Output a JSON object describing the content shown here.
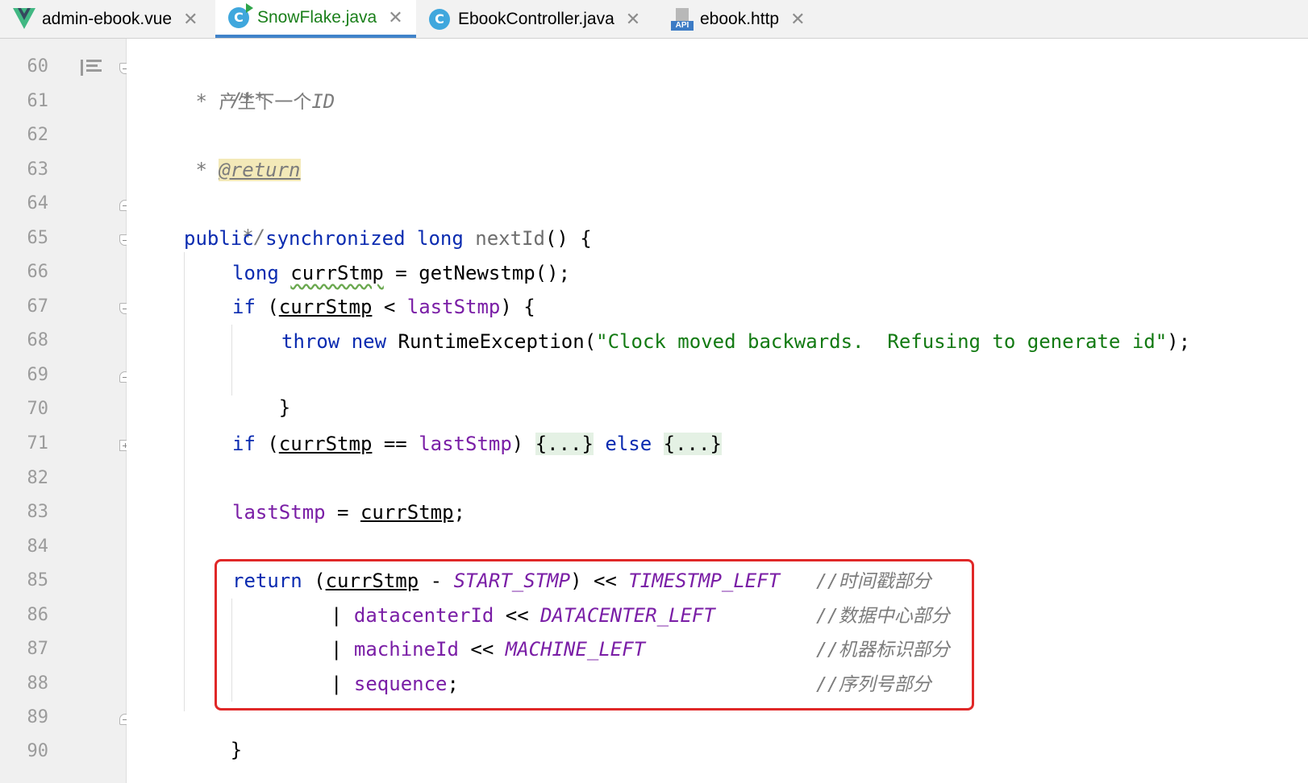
{
  "tabs": [
    {
      "label": "admin-ebook.vue",
      "icon": "vue-icon",
      "active": false
    },
    {
      "label": "SnowFlake.java",
      "icon": "java-class-icon",
      "active": true
    },
    {
      "label": "EbookController.java",
      "icon": "java-class-icon",
      "active": false
    },
    {
      "label": "ebook.http",
      "icon": "api-icon",
      "active": false
    }
  ],
  "tab_close_glyph": "✕",
  "line_numbers": [
    "60",
    "61",
    "62",
    "63",
    "64",
    "65",
    "66",
    "67",
    "68",
    "69",
    "70",
    "71",
    "82",
    "83",
    "84",
    "85",
    "86",
    "87",
    "88",
    "89",
    "90"
  ],
  "code": {
    "l60": "/**",
    "l61_star": " * ",
    "l61_text": "产生下一个",
    "l61_id": "ID",
    "l62": " *",
    "l63_star": " * ",
    "l63_tag": "@return",
    "l64": " */",
    "l65_public": "public",
    "l65_sync": "synchronized",
    "l65_long": "long",
    "l65_name": "nextId",
    "l65_rest": "() {",
    "l66_long": "long",
    "l66_var": "currStmp",
    "l66_rest": " = getNewstmp();",
    "l67_if": "if",
    "l67_open": " (",
    "l67_var": "currStmp",
    "l67_op": " < ",
    "l67_field": "lastStmp",
    "l67_close": ") {",
    "l68_throw": "throw",
    "l68_new": "new",
    "l68_cls": " RuntimeException(",
    "l68_str": "\"Clock moved backwards.  Refusing to generate id\"",
    "l68_end": ");",
    "l69": "}",
    "l71_if": "if",
    "l71_open": " (",
    "l71_var": "currStmp",
    "l71_op": " == ",
    "l71_field": "lastStmp",
    "l71_close": ") ",
    "l71_fold1": "{...}",
    "l71_else": "else",
    "l71_fold2": "{...}",
    "l83_field": "lastStmp",
    "l83_op": " = ",
    "l83_var": "currStmp",
    "l83_end": ";",
    "l85_return": "return",
    "l85_open": " (",
    "l85_var": "currStmp",
    "l85_minus": " - ",
    "l85_c1": "START_STMP",
    "l85_mid": ") << ",
    "l85_c2": "TIMESTMP_LEFT",
    "l85_cmt": "//时间戳部分",
    "l86_bar": "| ",
    "l86_field": "datacenterId",
    "l86_op": " << ",
    "l86_const": "DATACENTER_LEFT",
    "l86_cmt": "//数据中心部分",
    "l87_bar": "| ",
    "l87_field": "machineId",
    "l87_op": " << ",
    "l87_const": "MACHINE_LEFT",
    "l87_cmt": "//机器标识部分",
    "l88_bar": "| ",
    "l88_field": "sequence",
    "l88_end": ";",
    "l88_cmt": "//序列号部分",
    "l89": "}"
  },
  "colors": {
    "keyword": "#0a2bb0",
    "string": "#127a12",
    "field": "#7a1ea6",
    "comment": "#7c7c7c",
    "highlight_box": "#e02828",
    "active_tab": "#1a7f1a"
  }
}
